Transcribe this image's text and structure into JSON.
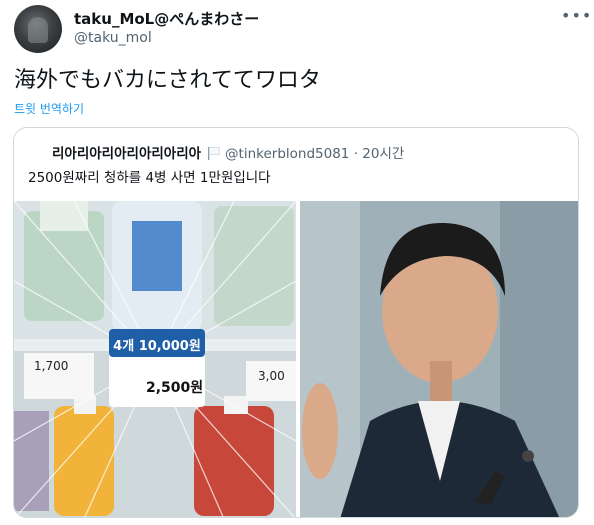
{
  "author": {
    "display_name": "taku_MoL@ぺんまわさー",
    "handle": "@taku_mol"
  },
  "tweet": {
    "text": "海外でもバカにされててワロタ",
    "translate_label": "트윗 번역하기"
  },
  "quoted": {
    "display_name": "리아리아리아리아리아리아",
    "handle": "@tinkerblond5081",
    "separator": "·",
    "time": "20시간",
    "text": "2500원짜리 청하를 4병 사면 1만원입니다",
    "photo_left": {
      "price_badge": "4개 10,000원",
      "price_tag": "2,500원",
      "left_tag": "1,700",
      "right_tag": "3,00"
    }
  },
  "colors": {
    "link": "#1d9bf0",
    "secondary_text": "#536471",
    "border": "#cfd9de",
    "badge_blue": "#1f5fa8"
  },
  "icons": {
    "more": "more-dots-icon",
    "flag": "flag-icon"
  }
}
